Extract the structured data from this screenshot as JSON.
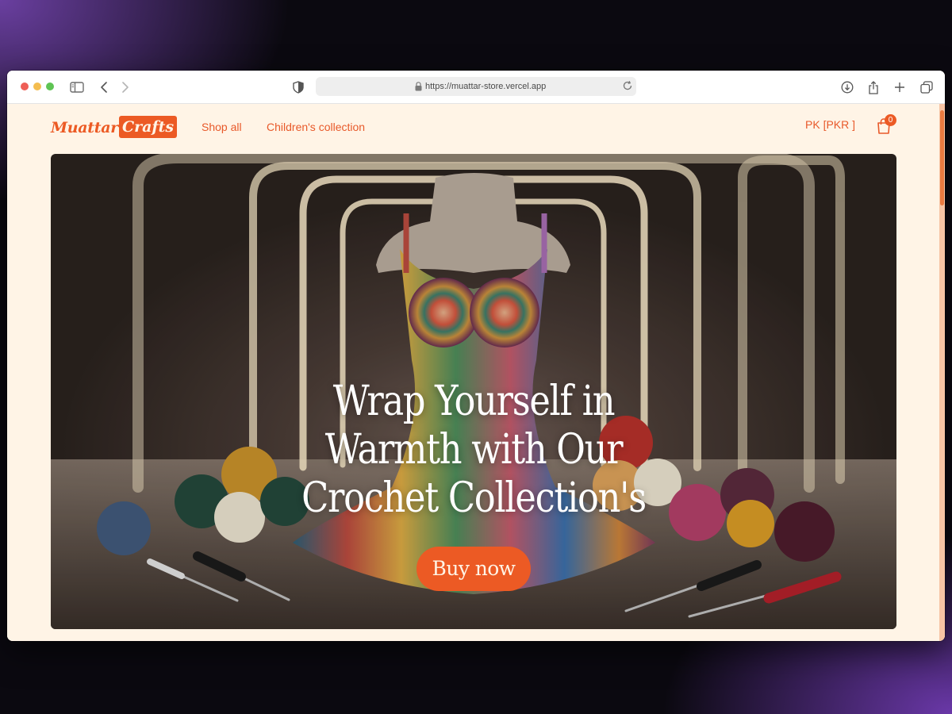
{
  "browser": {
    "url": "https://muattar-store.vercel.app"
  },
  "header": {
    "logo_part1": "Muattar",
    "logo_part2": "Crafts",
    "nav": [
      "Shop all",
      "Children's collection"
    ],
    "currency": "PK [PKR ]",
    "cart_count": "0"
  },
  "hero": {
    "title": "Wrap Yourself in Warmth with Our Crochet Collection's",
    "button_label": "Buy now"
  },
  "colors": {
    "accent": "#ec5a24",
    "page_background": "#fff4e6"
  },
  "icons": [
    "sidebar-icon",
    "back-arrow-icon",
    "forward-arrow-icon",
    "shield-icon",
    "lock-icon",
    "reload-icon",
    "download-icon",
    "share-icon",
    "plus-icon",
    "tabs-icon",
    "cart-icon"
  ]
}
